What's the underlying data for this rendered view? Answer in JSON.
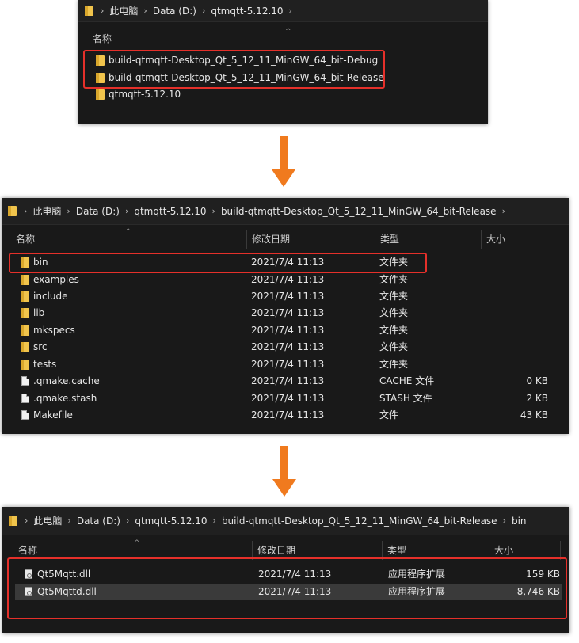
{
  "window1": {
    "breadcrumb": [
      "此电脑",
      "Data (D:)",
      "qtmqtt-5.12.10"
    ],
    "header_name": "名称",
    "items": [
      {
        "name": "build-qtmqtt-Desktop_Qt_5_12_11_MinGW_64_bit-Debug",
        "icon": "folder-icon"
      },
      {
        "name": "build-qtmqtt-Desktop_Qt_5_12_11_MinGW_64_bit-Release",
        "icon": "folder-icon"
      },
      {
        "name": "qtmqtt-5.12.10",
        "icon": "folder-icon"
      }
    ]
  },
  "window2": {
    "breadcrumb": [
      "此电脑",
      "Data (D:)",
      "qtmqtt-5.12.10",
      "build-qtmqtt-Desktop_Qt_5_12_11_MinGW_64_bit-Release"
    ],
    "headers": {
      "name": "名称",
      "date": "修改日期",
      "type": "类型",
      "size": "大小"
    },
    "rows": [
      {
        "name": "bin",
        "date": "2021/7/4 11:13",
        "type": "文件夹",
        "size": "",
        "icon": "folder-icon"
      },
      {
        "name": "examples",
        "date": "2021/7/4 11:13",
        "type": "文件夹",
        "size": "",
        "icon": "folder-icon"
      },
      {
        "name": "include",
        "date": "2021/7/4 11:13",
        "type": "文件夹",
        "size": "",
        "icon": "folder-icon"
      },
      {
        "name": "lib",
        "date": "2021/7/4 11:13",
        "type": "文件夹",
        "size": "",
        "icon": "folder-icon"
      },
      {
        "name": "mkspecs",
        "date": "2021/7/4 11:13",
        "type": "文件夹",
        "size": "",
        "icon": "folder-icon"
      },
      {
        "name": "src",
        "date": "2021/7/4 11:13",
        "type": "文件夹",
        "size": "",
        "icon": "folder-icon"
      },
      {
        "name": "tests",
        "date": "2021/7/4 11:13",
        "type": "文件夹",
        "size": "",
        "icon": "folder-icon"
      },
      {
        "name": ".qmake.cache",
        "date": "2021/7/4 11:13",
        "type": "CACHE 文件",
        "size": "0 KB",
        "icon": "file-icon"
      },
      {
        "name": ".qmake.stash",
        "date": "2021/7/4 11:13",
        "type": "STASH 文件",
        "size": "2 KB",
        "icon": "file-icon"
      },
      {
        "name": "Makefile",
        "date": "2021/7/4 11:13",
        "type": "文件",
        "size": "43 KB",
        "icon": "file-icon"
      }
    ]
  },
  "window3": {
    "breadcrumb": [
      "此电脑",
      "Data (D:)",
      "qtmqtt-5.12.10",
      "build-qtmqtt-Desktop_Qt_5_12_11_MinGW_64_bit-Release",
      "bin"
    ],
    "headers": {
      "name": "名称",
      "date": "修改日期",
      "type": "类型",
      "size": "大小"
    },
    "rows": [
      {
        "name": "Qt5Mqtt.dll",
        "date": "2021/7/4 11:13",
        "type": "应用程序扩展",
        "size": "159 KB",
        "icon": "dll-file-icon"
      },
      {
        "name": "Qt5Mqttd.dll",
        "date": "2021/7/4 11:13",
        "type": "应用程序扩展",
        "size": "8,746 KB",
        "icon": "dll-file-icon"
      }
    ]
  },
  "colors": {
    "window_bg": "#191919",
    "highlight_box": "#e5302a",
    "arrow": "#f07a1e",
    "folder": "#f0c44c"
  }
}
